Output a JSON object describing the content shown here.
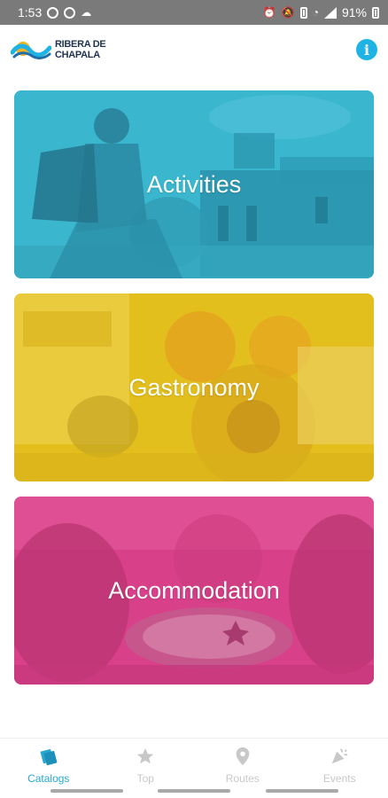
{
  "status_bar": {
    "time": "1:53",
    "battery": "91%",
    "left_icons": [
      "whatsapp-icon",
      "dnd-icon",
      "cloud-icon"
    ],
    "right_icons": [
      "alarm-icon",
      "mute-icon",
      "battery-saver-icon",
      "wifi-icon",
      "signal-icon",
      "battery-icon"
    ]
  },
  "header": {
    "logo_line1": "RIBERA DE",
    "logo_line2": "CHAPALA",
    "info_label": "i"
  },
  "categories": [
    {
      "label": "Activities",
      "color": "#3ab7cf"
    },
    {
      "label": "Gastronomy",
      "color": "#e3bf1e"
    },
    {
      "label": "Accommodation",
      "color": "#d9408a"
    }
  ],
  "bottom_nav": {
    "active_color": "#27a8d3",
    "inactive_color": "#c8c8c8",
    "items": [
      {
        "label": "Catalogs",
        "icon": "catalog-icon",
        "active": true
      },
      {
        "label": "Top",
        "icon": "star-icon",
        "active": false
      },
      {
        "label": "Routes",
        "icon": "map-pin-icon",
        "active": false
      },
      {
        "label": "Events",
        "icon": "party-icon",
        "active": false
      }
    ]
  }
}
